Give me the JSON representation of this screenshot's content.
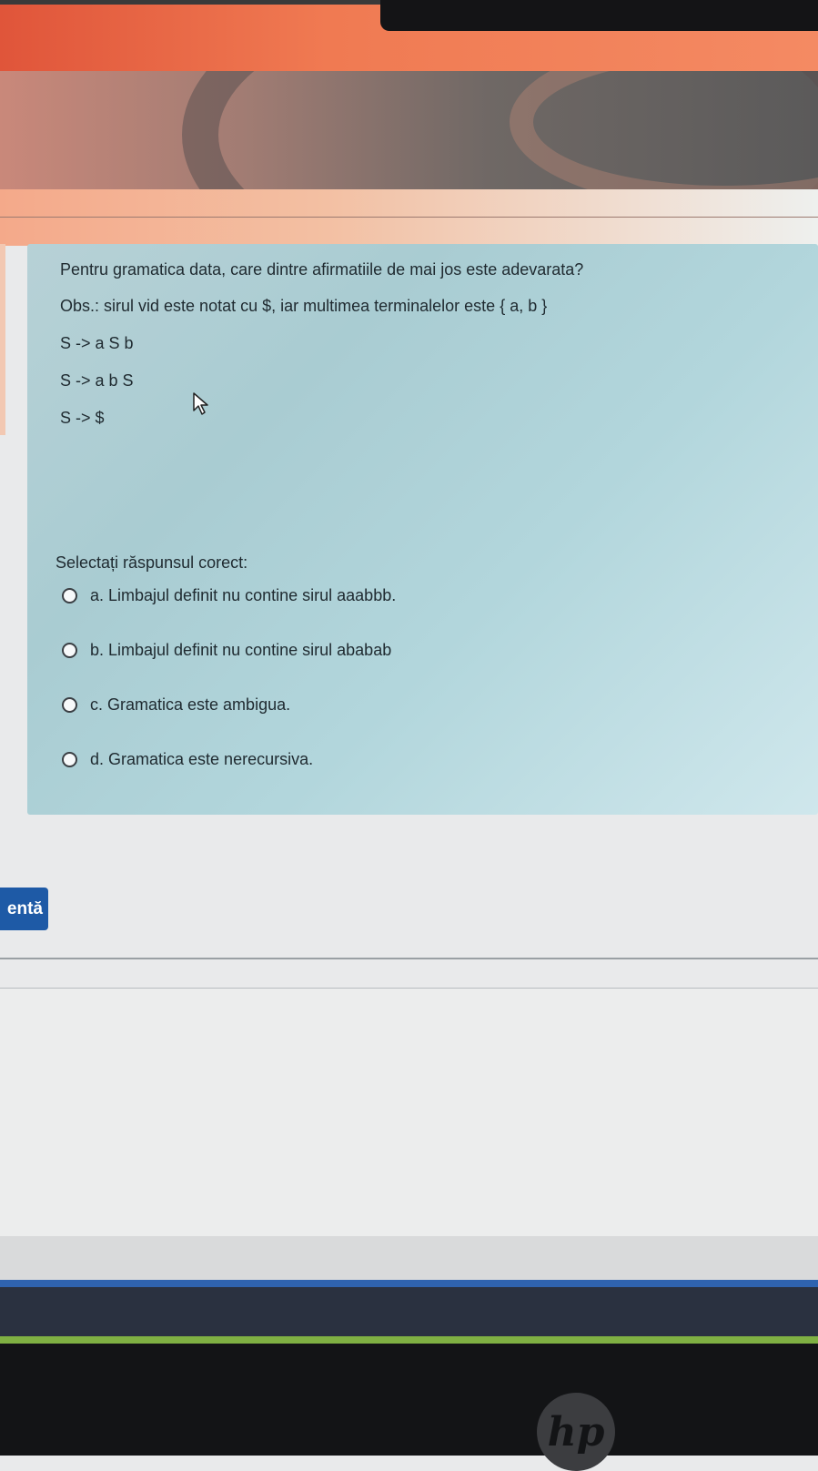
{
  "question": {
    "text": "Pentru gramatica data, care dintre afirmatiile de mai jos este adevarata?",
    "note": "Obs.: sirul vid este notat cu $, iar multimea terminalelor este { a, b }",
    "rules": [
      "S -> a S b",
      "S -> a b S",
      "S -> $"
    ]
  },
  "answer": {
    "prompt": "Selectați răspunsul corect:",
    "options": [
      "a. Limbajul definit nu contine sirul aaabbb.",
      "b. Limbajul definit nu contine sirul ababab",
      "c. Gramatica este ambigua.",
      "d. Gramatica este nerecursiva."
    ]
  },
  "navigation": {
    "next_label": "entă"
  },
  "icons": {
    "cursor": "mouse-pointer-icon",
    "radio": "radio-button-icon",
    "brand": "hp-logo-icon"
  },
  "footer": {
    "brand": "hp"
  }
}
